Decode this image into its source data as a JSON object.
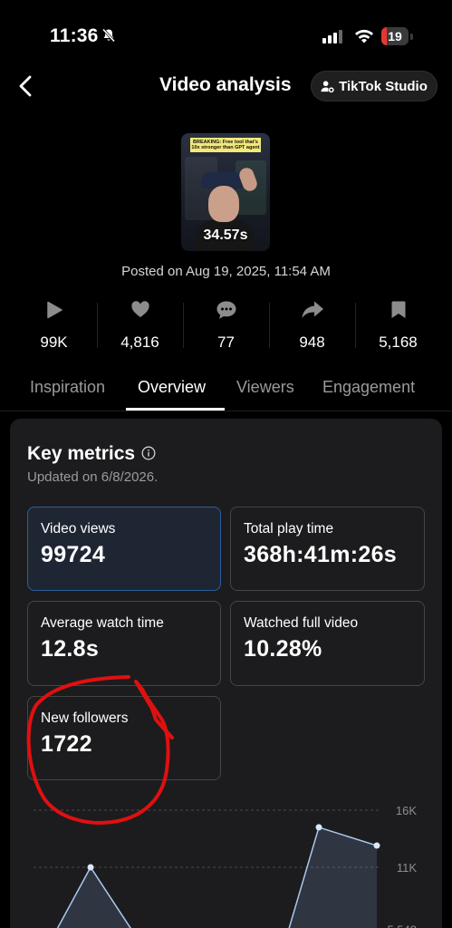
{
  "status_bar": {
    "time": "11:36",
    "battery": "19",
    "battery_level": 0.19
  },
  "header": {
    "title": "Video analysis",
    "studio_button": "TikTok Studio"
  },
  "video": {
    "banner_text": "BREAKING: Free tool that's 10x stronger than GPT agent",
    "duration": "34.57s",
    "posted": "Posted on Aug 19, 2025, 11:54 AM"
  },
  "stats": [
    {
      "icon": "play-icon",
      "value": "99K"
    },
    {
      "icon": "heart-icon",
      "value": "4,816"
    },
    {
      "icon": "comment-icon",
      "value": "77"
    },
    {
      "icon": "share-icon",
      "value": "948"
    },
    {
      "icon": "bookmark-icon",
      "value": "5,168"
    }
  ],
  "tabs": [
    "Inspiration",
    "Overview",
    "Viewers",
    "Engagement"
  ],
  "active_tab": "Overview",
  "key_metrics": {
    "title": "Key metrics",
    "updated": "Updated on 6/8/2026.",
    "items": [
      {
        "label": "Video views",
        "value": "99724",
        "selected": true
      },
      {
        "label": "Total play time",
        "value": "368h:41m:26s"
      },
      {
        "label": "Average watch time",
        "value": "12.8s"
      },
      {
        "label": "Watched full video",
        "value": "10.28%"
      },
      {
        "label": "New followers",
        "value": "1722"
      }
    ]
  },
  "chart_data": {
    "type": "area",
    "y_tick_labels": [
      "16K",
      "11K",
      "5,548"
    ],
    "ylim": [
      0,
      16000
    ],
    "grid": "dashed horizontal",
    "series": [
      {
        "points": [
          {
            "x": 0,
            "y": 0
          },
          {
            "x": 1,
            "y": 11000
          },
          {
            "x": 2,
            "y": 0
          },
          {
            "x": 3,
            "y": 0
          },
          {
            "x": 4,
            "y": 14500
          },
          {
            "x": 5,
            "y": 12900
          }
        ]
      }
    ]
  },
  "colors": {
    "accent_border": "#2b5f9e",
    "annotation": "#e01010",
    "chart_line": "#a9c9ef"
  }
}
